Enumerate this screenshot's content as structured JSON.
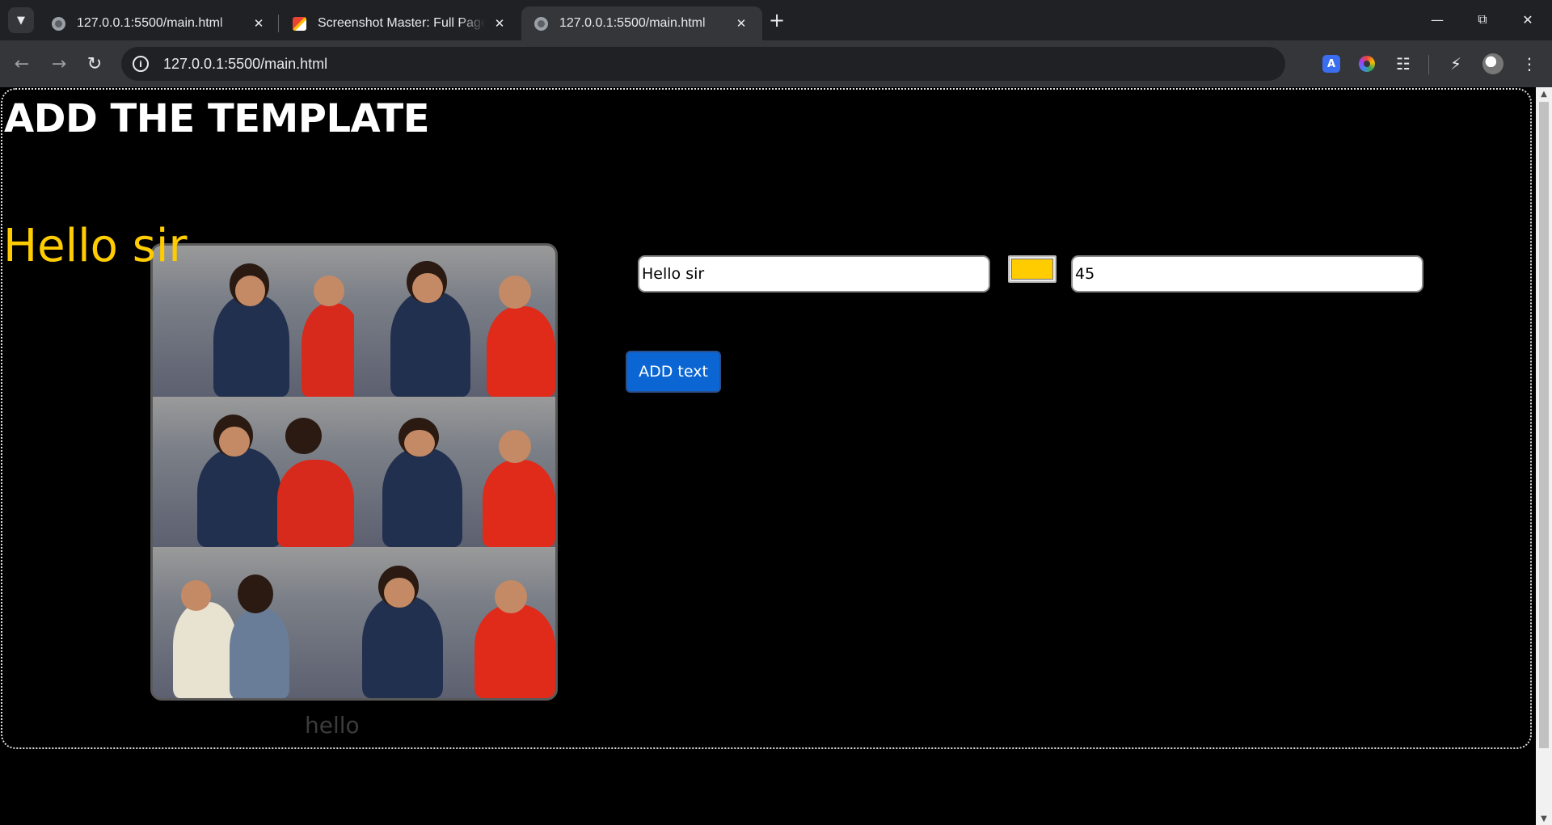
{
  "browser": {
    "tabs": [
      {
        "title": "127.0.0.1:5500/main.html",
        "active": false,
        "favicon": "globe-icon"
      },
      {
        "title": "Screenshot Master: Full Page Ca",
        "active": false,
        "favicon": "screenshot-master-icon"
      },
      {
        "title": "127.0.0.1:5500/main.html",
        "active": true,
        "favicon": "globe-icon"
      }
    ],
    "url": "127.0.0.1:5500/main.html"
  },
  "page": {
    "title": "ADD THE TEMPLATE",
    "overlay_text": "Hello sir",
    "overlay_color": "#ffcc00",
    "caption": "hello",
    "text_input_value": "Hello sir",
    "color_value": "#ffcc00",
    "size_input_value": "45",
    "add_button_label": "ADD text"
  },
  "colors": {
    "background": "#000000",
    "button": "#0b66d4",
    "title": "#ffffff"
  }
}
